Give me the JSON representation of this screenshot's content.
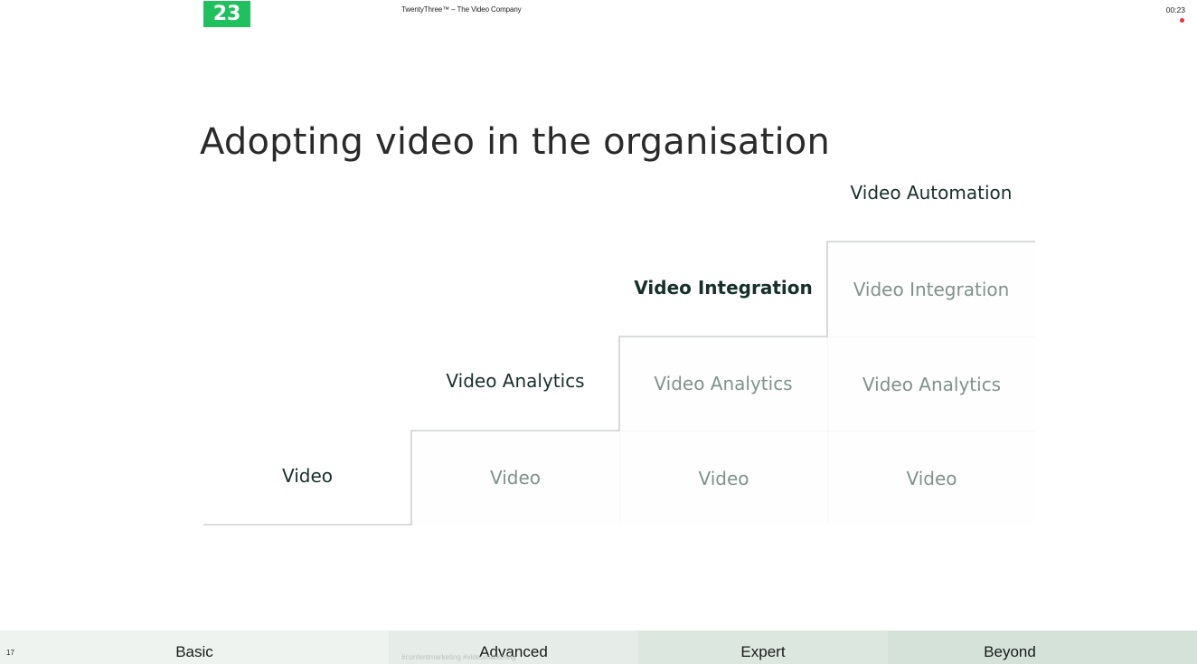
{
  "header": {
    "logo_text": "23",
    "company": "TwentyThree™ – The Video Company",
    "timer": "00:23",
    "recording_indicator": "recording-dot"
  },
  "slide": {
    "title": "Adopting video in the organisation",
    "levels": [
      {
        "name": "Basic",
        "new_capability": "Video",
        "inherited": []
      },
      {
        "name": "Advanced",
        "new_capability": "Video Analytics",
        "inherited": [
          "Video"
        ]
      },
      {
        "name": "Expert",
        "new_capability": "Video Integration",
        "inherited": [
          "Video Analytics",
          "Video"
        ]
      },
      {
        "name": "Beyond",
        "new_capability": "Video Automation",
        "inherited": [
          "Video Integration",
          "Video Analytics",
          "Video"
        ]
      }
    ]
  },
  "footer": {
    "page_number": "17",
    "hashtags": "#contentmarketing #videomarketing",
    "tabs": [
      "Basic",
      "Advanced",
      "Expert",
      "Beyond"
    ]
  },
  "colors": {
    "brand_green": "#1fc05e",
    "heading_text": "#16302a",
    "muted_text": "#7f928c",
    "recording_red": "#e8323c"
  }
}
